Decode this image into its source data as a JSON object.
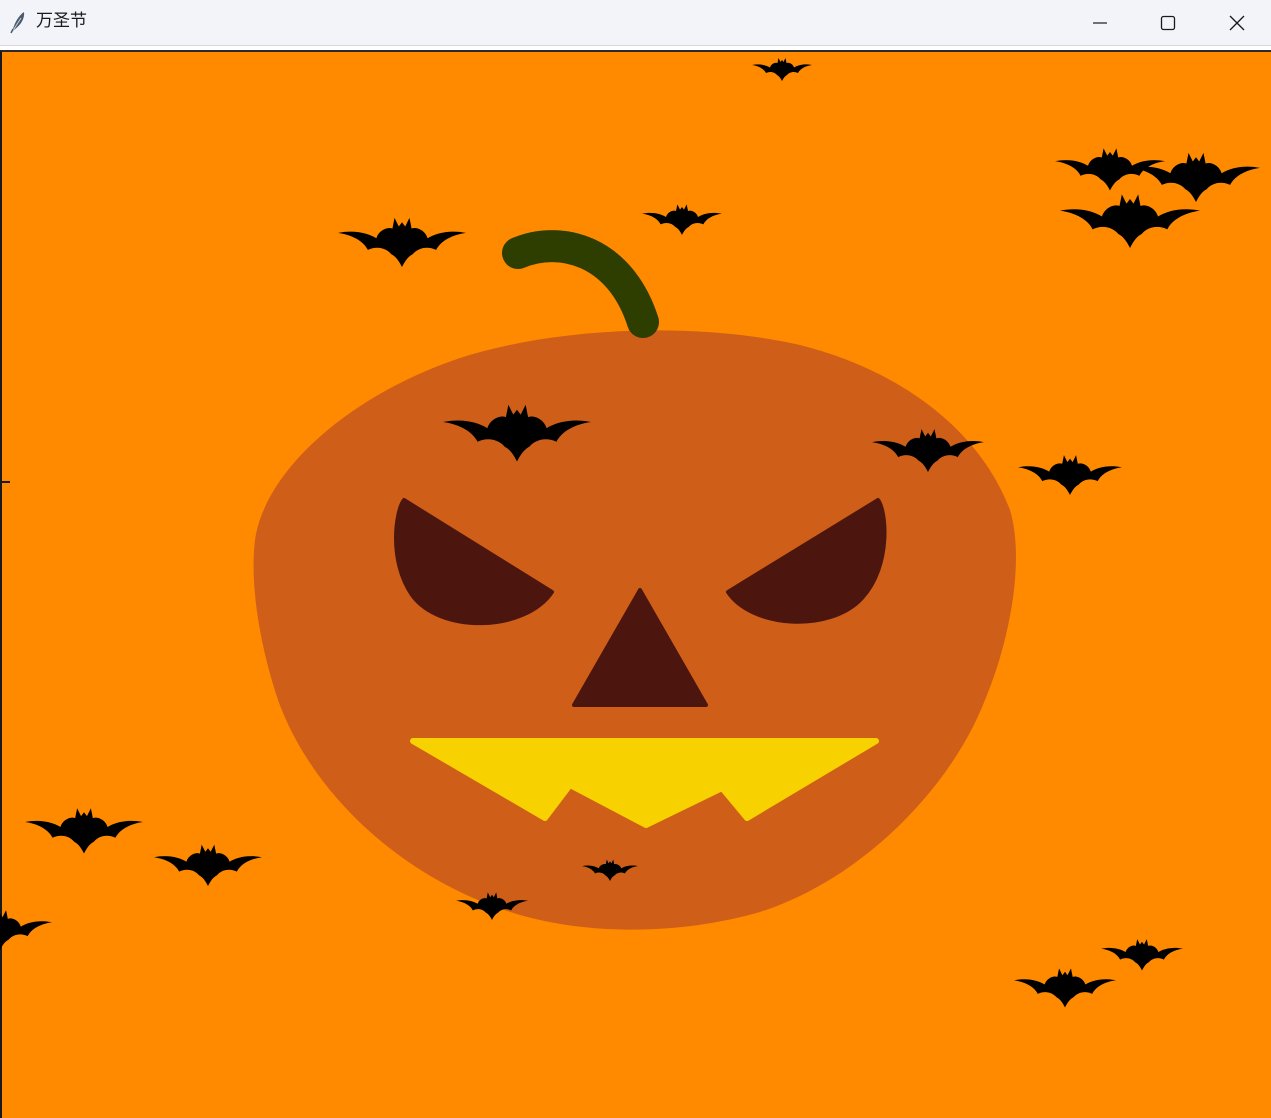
{
  "window": {
    "title": "万圣节",
    "app_icon": "feather-icon",
    "controls": {
      "minimize": "minimize-icon",
      "maximize": "maximize-icon",
      "close": "close-icon"
    }
  },
  "scene": {
    "background_color": "#ff8a00",
    "pumpkin_color": "#cf5f18",
    "stem_color": "#2e3d00",
    "eye_nose_color": "#4c160e",
    "mouth_color": "#f8d100",
    "bat_color": "#000000"
  }
}
